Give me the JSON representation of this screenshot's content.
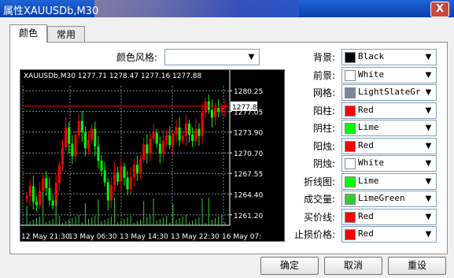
{
  "window": {
    "title": "属性XAUUSDb,M30",
    "close_glyph": "X"
  },
  "tabs": [
    {
      "label": "颜色",
      "active": true
    },
    {
      "label": "常用",
      "active": false
    }
  ],
  "color_scheme": {
    "label": "颜色风格:",
    "value": ""
  },
  "colors": [
    {
      "label": "背景:",
      "value": "Black",
      "swatch": "#000000"
    },
    {
      "label": "前景:",
      "value": "White",
      "swatch": "#ffffff"
    },
    {
      "label": "网格:",
      "value": "LightSlateGr",
      "swatch": "#778899"
    },
    {
      "label": "阳柱:",
      "value": "Red",
      "swatch": "#ff0000"
    },
    {
      "label": "阴柱:",
      "value": "Lime",
      "swatch": "#00ff00"
    },
    {
      "label": "阳烛:",
      "value": "Red",
      "swatch": "#ff0000"
    },
    {
      "label": "阴烛:",
      "value": "White",
      "swatch": "#ffffff"
    },
    {
      "label": "折线图:",
      "value": "Lime",
      "swatch": "#00ff00"
    },
    {
      "label": "成交量:",
      "value": "LimeGreen",
      "swatch": "#32cd32"
    },
    {
      "label": "买价线:",
      "value": "Red",
      "swatch": "#ff0000"
    },
    {
      "label": "止损价格:",
      "value": "Red",
      "swatch": "#ff0000"
    }
  ],
  "chart": {
    "header": "XAUUSDb,M30  1277.71 1278.47 1277.16 1277.88",
    "y_ticks": [
      "1280.25",
      "1277.05",
      "1273.90",
      "1270.70",
      "1267.55",
      "1264.40",
      "1261.20"
    ],
    "x_ticks": [
      "12 May 21:30",
      "13 May 06:30",
      "13 May 14:30",
      "13 May 22:30",
      "16 May 07:"
    ],
    "price_label": "1277.88",
    "bid": 1277.88,
    "ylim": [
      1259.6,
      1281.0
    ]
  },
  "buttons": {
    "ok": "确定",
    "cancel": "取消",
    "reset": "重设"
  }
}
